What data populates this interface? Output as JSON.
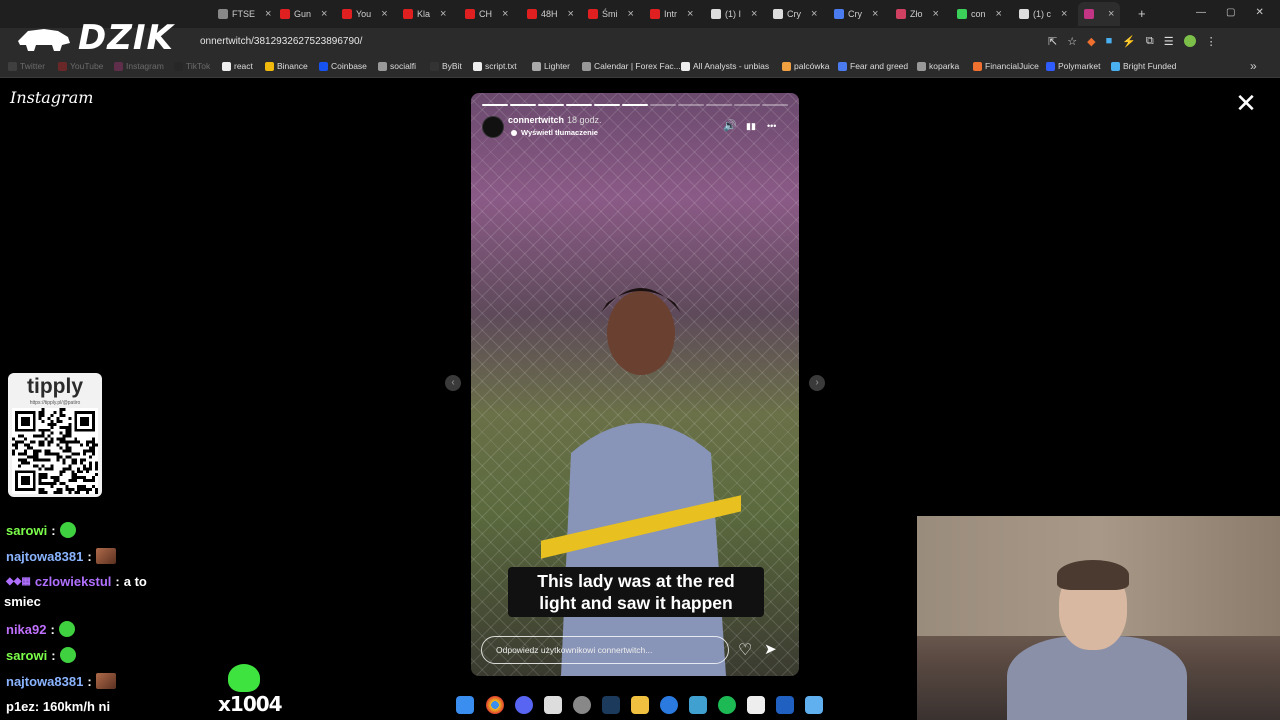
{
  "browser": {
    "tabs": [
      {
        "label": "FTSE",
        "color": "#888888"
      },
      {
        "label": "Gun",
        "color": "#e02020"
      },
      {
        "label": "You",
        "color": "#e02020"
      },
      {
        "label": "Kla",
        "color": "#e02020"
      },
      {
        "label": "CH",
        "color": "#e02020"
      },
      {
        "label": "48H",
        "color": "#e02020"
      },
      {
        "label": "Śmi",
        "color": "#e02020"
      },
      {
        "label": "Intr",
        "color": "#e02020"
      },
      {
        "label": "(1) I",
        "color": "#dddddd"
      },
      {
        "label": "Cry",
        "color": "#dddddd"
      },
      {
        "label": "Cry",
        "color": "#4a7cf0"
      },
      {
        "label": "Zło",
        "color": "#d04060"
      },
      {
        "label": "con",
        "color": "#3ad05a"
      },
      {
        "label": "(1) c",
        "color": "#dddddd"
      },
      {
        "label": "",
        "color": "#c13584"
      }
    ],
    "new_tab": "+",
    "window_controls": [
      "—",
      "▢",
      "✕"
    ],
    "url": "onnertwitch/3812932627523896790/",
    "bookmarks": [
      {
        "label": "Twitter",
        "color": "#666666"
      },
      {
        "label": "YouTube",
        "color": "#e02020"
      },
      {
        "label": "Instagram",
        "color": "#c13584"
      },
      {
        "label": "TikTok",
        "color": "#222222"
      },
      {
        "label": "react",
        "color": "#eeeeee"
      },
      {
        "label": "Binance",
        "color": "#f0b90b"
      },
      {
        "label": "Coinbase",
        "color": "#1652f0"
      },
      {
        "label": "socialfi",
        "color": "#999999"
      },
      {
        "label": "ByBit",
        "color": "#333333"
      },
      {
        "label": "script.txt",
        "color": "#eeeeee"
      },
      {
        "label": "Lighter",
        "color": "#aaaaaa"
      },
      {
        "label": "Calendar | Forex Fac...",
        "color": "#999999"
      },
      {
        "label": "All Analysts - unbias",
        "color": "#eeeeee"
      },
      {
        "label": "palcówka",
        "color": "#f0a040"
      },
      {
        "label": "Fear and greed",
        "color": "#4a7cf0"
      },
      {
        "label": "koparka",
        "color": "#999999"
      },
      {
        "label": "FinancialJuice",
        "color": "#f07030"
      },
      {
        "label": "Polymarket",
        "color": "#2e5cff"
      },
      {
        "label": "Bright Funded",
        "color": "#4ab0f0"
      }
    ],
    "more_bookmarks": "»"
  },
  "overlay": {
    "logo_text": "DZIK"
  },
  "instagram": {
    "brand": "Instagram",
    "close": "✕",
    "story": {
      "username": "connertwitch",
      "time": "18 godz.",
      "translate": "Wyświetl tłumaczenie",
      "progress_segments": 11,
      "progress_done": 6,
      "caption_line1": "This lady was at the red",
      "caption_line2": "light and saw it happen",
      "reply_placeholder": "Odpowiedz użytkownikowi connertwitch...",
      "controls": {
        "sound": "🔊",
        "pause": "▮▮",
        "more": "•••"
      },
      "like": "♡",
      "share": "➤",
      "prev": "‹",
      "next": "›"
    }
  },
  "tipply": {
    "title": "tipply",
    "url": "https://tipply.pl/@patiro"
  },
  "chat": {
    "messages": [
      {
        "user": "sarowi",
        "sep": ":",
        "text": "",
        "user_color": "#7cff4a",
        "emote": "green"
      },
      {
        "user": "najtowa8381",
        "sep": ":",
        "text": "",
        "user_color": "#8ab4ff",
        "emote": "pic"
      },
      {
        "user": "czlowiekstul",
        "sep": ":",
        "text": "a to",
        "user_color": "#b070ff",
        "emote": ""
      },
      {
        "user": "nika92",
        "sep": ":",
        "text": "",
        "user_color": "#c070ff",
        "emote": "green"
      },
      {
        "user": "sarowi",
        "sep": ":",
        "text": "",
        "user_color": "#7cff4a",
        "emote": "green"
      },
      {
        "user": "najtowa8381",
        "sep": ":",
        "text": "",
        "user_color": "#8ab4ff",
        "emote": "pic"
      }
    ],
    "wrap_text": "smiec",
    "bottom_user": "p1ez",
    "bottom_text": "160km/h ni",
    "counter": "x1004"
  }
}
